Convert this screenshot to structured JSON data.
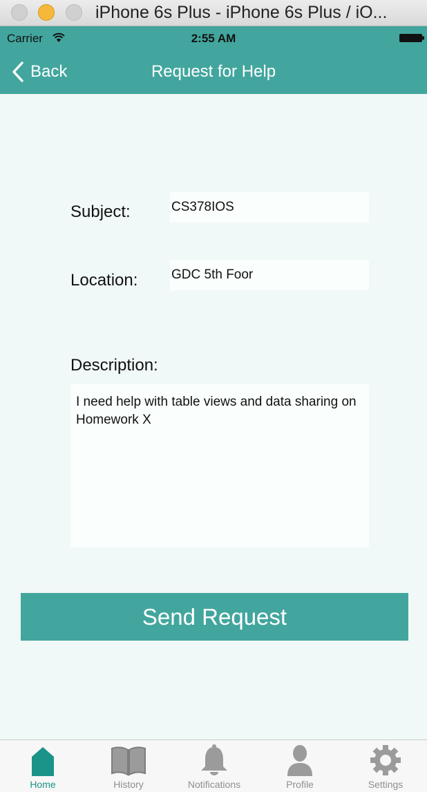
{
  "window": {
    "title": "iPhone 6s Plus - iPhone 6s Plus / iO..."
  },
  "status_bar": {
    "carrier": "Carrier",
    "time": "2:55 AM"
  },
  "nav": {
    "back_label": "Back",
    "title": "Request for Help"
  },
  "form": {
    "subject_label": "Subject:",
    "subject_value": "CS378IOS",
    "location_label": "Location:",
    "location_value": "GDC 5th Foor",
    "description_label": "Description:",
    "description_value": "I need help with table views and data sharing on Homework X"
  },
  "send_button_label": "Send Request",
  "tab_bar": {
    "items": [
      {
        "label": "Home",
        "icon": "home-icon",
        "active": true
      },
      {
        "label": "History",
        "icon": "book-icon",
        "active": false
      },
      {
        "label": "Notifications",
        "icon": "bell-icon",
        "active": false
      },
      {
        "label": "Profile",
        "icon": "person-icon",
        "active": false
      },
      {
        "label": "Settings",
        "icon": "gear-icon",
        "active": false
      }
    ]
  },
  "colors": {
    "accent": "#42a69e",
    "active_tab": "#1a9389",
    "inactive_tab": "#8e8e8e",
    "background": "#f1f9f8"
  }
}
